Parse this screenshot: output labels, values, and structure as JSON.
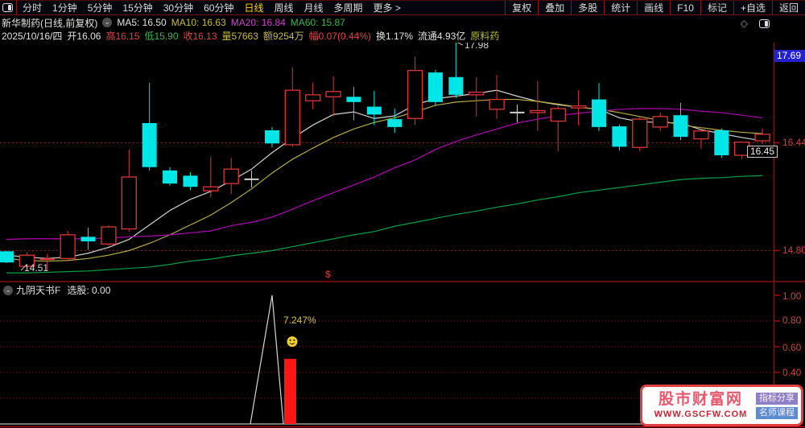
{
  "toolbar": {
    "periods": [
      "分时",
      "1分钟",
      "5分钟",
      "15分钟",
      "30分钟",
      "60分钟",
      "日线",
      "周线",
      "月线",
      "多周期",
      "更多 >"
    ],
    "active_period": "日线",
    "tools": [
      "复权",
      "叠加",
      "多股",
      "统计",
      "画线",
      "F10",
      "标记",
      "+自选",
      "返回"
    ]
  },
  "quote": {
    "title": "新华制药(日线,前复权)",
    "ma": [
      "MA5: 16.50",
      "MA10: 16.63",
      "MA20: 16.84",
      "MA60: 15.87"
    ],
    "info": {
      "date": "2025/10/16/四",
      "open": "开16.06",
      "high": "高16.15",
      "low": "低15.90",
      "close": "收16.13",
      "volume": "量57663",
      "amount": "额9254万",
      "change": "幅0.07(0.44%)",
      "turnover": "换1.17%",
      "float": "流通4.93亿",
      "sector": "原料药"
    }
  },
  "chart_data": {
    "type": "candlestick",
    "colors": {
      "up": "#e03535",
      "down": "#00e5e5",
      "flat": "#cfcfcf"
    },
    "candles": [
      [
        14.79,
        14.8,
        14.61,
        14.62,
        "d"
      ],
      [
        14.56,
        14.78,
        14.51,
        14.73,
        "u"
      ],
      [
        14.66,
        14.75,
        14.49,
        14.68,
        "u"
      ],
      [
        14.68,
        15.1,
        14.64,
        15.04,
        "u"
      ],
      [
        15.01,
        15.15,
        14.81,
        14.94,
        "d"
      ],
      [
        14.9,
        15.19,
        14.87,
        15.16,
        "u"
      ],
      [
        15.13,
        16.34,
        15.09,
        15.92,
        "u"
      ],
      [
        16.74,
        17.35,
        16.02,
        16.07,
        "d"
      ],
      [
        16.02,
        16.07,
        15.79,
        15.82,
        "d"
      ],
      [
        15.94,
        15.99,
        15.72,
        15.77,
        "d"
      ],
      [
        15.71,
        16.23,
        15.61,
        15.77,
        "u"
      ],
      [
        15.82,
        16.21,
        15.66,
        16.04,
        "u"
      ],
      [
        15.88,
        16.02,
        15.76,
        15.89,
        "f"
      ],
      [
        16.63,
        16.68,
        16.37,
        16.43,
        "d"
      ],
      [
        16.41,
        17.59,
        16.38,
        17.24,
        "u"
      ],
      [
        17.08,
        17.35,
        16.95,
        17.17,
        "u"
      ],
      [
        17.14,
        17.45,
        16.84,
        17.22,
        "u"
      ],
      [
        17.14,
        17.29,
        16.78,
        17.06,
        "d"
      ],
      [
        16.99,
        17.23,
        16.71,
        16.87,
        "d"
      ],
      [
        16.8,
        16.96,
        16.59,
        16.68,
        "d"
      ],
      [
        16.81,
        17.75,
        16.71,
        17.54,
        "u"
      ],
      [
        17.51,
        17.55,
        17.0,
        17.06,
        "d"
      ],
      [
        17.44,
        17.98,
        17.12,
        17.17,
        "d"
      ],
      [
        17.17,
        17.44,
        16.84,
        17.21,
        "u"
      ],
      [
        16.95,
        17.47,
        16.8,
        17.1,
        "u"
      ],
      [
        16.89,
        17.02,
        16.75,
        16.91,
        "f"
      ],
      [
        16.9,
        17.38,
        16.62,
        16.93,
        "u"
      ],
      [
        16.77,
        17.0,
        16.31,
        16.96,
        "u"
      ],
      [
        16.97,
        17.24,
        16.71,
        17.0,
        "u"
      ],
      [
        17.1,
        17.35,
        16.62,
        16.68,
        "d"
      ],
      [
        16.69,
        16.72,
        16.32,
        16.38,
        "d"
      ],
      [
        16.37,
        16.84,
        16.31,
        16.8,
        "u"
      ],
      [
        16.68,
        16.9,
        16.62,
        16.84,
        "u"
      ],
      [
        16.86,
        17.05,
        16.48,
        16.53,
        "d"
      ],
      [
        16.5,
        16.68,
        16.35,
        16.62,
        "u"
      ],
      [
        16.63,
        16.66,
        16.21,
        16.25,
        "d"
      ],
      [
        16.25,
        16.46,
        16.19,
        16.45,
        "u"
      ],
      [
        16.47,
        16.66,
        16.42,
        16.57,
        "u"
      ]
    ],
    "ma": [
      {
        "name": "MA5",
        "color": "#d2d2d2",
        "values": [
          14.73,
          14.7,
          14.68,
          14.7,
          14.76,
          14.85,
          14.97,
          15.19,
          15.41,
          15.58,
          15.7,
          15.86,
          16.04,
          16.29,
          16.51,
          16.71,
          16.87,
          16.91,
          16.81,
          16.85,
          17.02,
          17.11,
          17.15,
          17.19,
          17.24,
          17.15,
          17.07,
          17.02,
          16.98,
          16.95,
          16.82,
          16.76,
          16.75,
          16.74,
          16.64,
          16.58,
          16.52,
          16.47
        ]
      },
      {
        "name": "MA10",
        "color": "#b9ab40",
        "values": [
          14.68,
          14.65,
          14.64,
          14.65,
          14.68,
          14.73,
          14.8,
          14.91,
          15.04,
          15.19,
          15.34,
          15.53,
          15.74,
          15.98,
          16.19,
          16.36,
          16.52,
          16.65,
          16.75,
          16.82,
          16.91,
          17.01,
          17.06,
          17.08,
          17.1,
          17.1,
          17.07,
          17.03,
          16.98,
          16.95,
          16.9,
          16.84,
          16.78,
          16.71,
          16.67,
          16.63,
          16.6,
          16.58
        ]
      },
      {
        "name": "MA20",
        "color": "#b400b4",
        "values": [
          14.97,
          14.98,
          14.98,
          14.98,
          14.98,
          14.99,
          15.01,
          15.02,
          15.04,
          15.07,
          15.1,
          15.18,
          15.23,
          15.31,
          15.43,
          15.56,
          15.68,
          15.8,
          15.92,
          16.06,
          16.18,
          16.34,
          16.46,
          16.56,
          16.65,
          16.74,
          16.8,
          16.85,
          16.89,
          16.92,
          16.95,
          16.96,
          16.96,
          16.95,
          16.92,
          16.9,
          16.86,
          16.82
        ]
      },
      {
        "name": "MA60",
        "color": "#00a443",
        "values": [
          14.46,
          14.46,
          14.47,
          14.48,
          14.49,
          14.51,
          14.53,
          14.55,
          14.59,
          14.64,
          14.67,
          14.72,
          14.76,
          14.8,
          14.86,
          14.92,
          14.98,
          15.04,
          15.09,
          15.17,
          15.23,
          15.29,
          15.35,
          15.4,
          15.46,
          15.51,
          15.57,
          15.62,
          15.68,
          15.72,
          15.76,
          15.8,
          15.84,
          15.88,
          15.9,
          15.91,
          15.93,
          15.94
        ]
      }
    ],
    "levels": [
      {
        "price": 16.44,
        "label": "16.44"
      },
      {
        "price": 14.8,
        "label": "14.80"
      }
    ],
    "labels": {
      "badge": "17.69",
      "level_high": "16.44",
      "level_low": "14.80",
      "last_price": "16.45",
      "high_note": "17.98",
      "low_note": "14.51",
      "marker": "$"
    }
  },
  "subchart": {
    "name": "九阴天书F",
    "param": "选股: 0.00",
    "value_label": "7.247%",
    "y_ticks": [
      "1.00",
      "0.80",
      "0.60",
      "0.40"
    ],
    "gridlines": [
      0.8,
      0.6,
      0.4,
      0.2
    ],
    "line_points": [
      [
        311,
        0
      ],
      [
        338,
        1.0
      ],
      [
        352,
        0
      ]
    ],
    "bar": {
      "x": 360.5,
      "value": 0.506,
      "color": "#ff1515"
    },
    "smiley": {
      "x": 363,
      "value": 0.64,
      "color": "#f2d024"
    }
  },
  "watermark": {
    "title": "股市财富网",
    "url": "WWW.GSCFW.COM",
    "badge1": "指标分享",
    "badge2": "名师课程"
  }
}
